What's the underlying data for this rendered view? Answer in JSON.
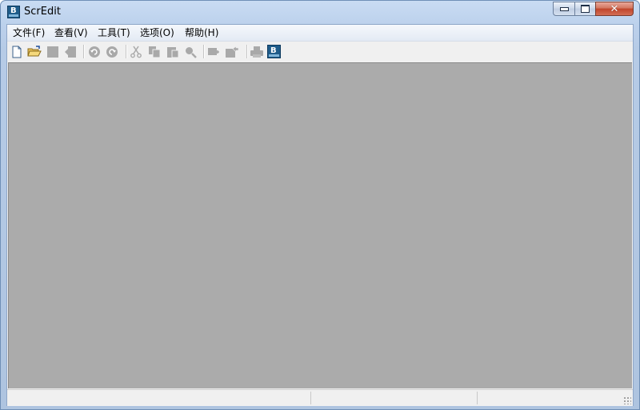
{
  "window": {
    "title": "ScrEdit",
    "app_icon_letter": "B"
  },
  "caption_buttons": {
    "minimize_icon": "minimize-icon",
    "maximize_icon": "maximize-icon",
    "close_glyph": "✕"
  },
  "menu": {
    "items": [
      {
        "label": "文件(F)"
      },
      {
        "label": "查看(V)"
      },
      {
        "label": "工具(T)"
      },
      {
        "label": "选项(O)"
      },
      {
        "label": "帮助(H)"
      }
    ]
  },
  "toolbar": {
    "buttons": [
      {
        "icon": "new-file-icon",
        "enabled": true
      },
      {
        "icon": "open-folder-icon",
        "enabled": true
      },
      {
        "icon": "save-icon",
        "enabled": false
      },
      {
        "icon": "close-doc-icon",
        "enabled": false
      },
      {
        "icon": "undo-icon",
        "enabled": false
      },
      {
        "icon": "redo-icon",
        "enabled": false
      },
      {
        "icon": "cut-icon",
        "enabled": false
      },
      {
        "icon": "copy-icon",
        "enabled": false
      },
      {
        "icon": "paste-icon",
        "enabled": false
      },
      {
        "icon": "find-icon",
        "enabled": false
      },
      {
        "icon": "insert-icon",
        "enabled": false
      },
      {
        "icon": "export-icon",
        "enabled": false
      },
      {
        "icon": "print-icon",
        "enabled": false
      },
      {
        "icon": "app-logo-icon",
        "enabled": true
      }
    ],
    "logo_letter": "B"
  },
  "colors": {
    "canvas_bg": "#ababab",
    "disabled_icon": "#a9a9a9",
    "accent": "#1f5c8a"
  },
  "status": {
    "panels": [
      "",
      "",
      ""
    ]
  }
}
